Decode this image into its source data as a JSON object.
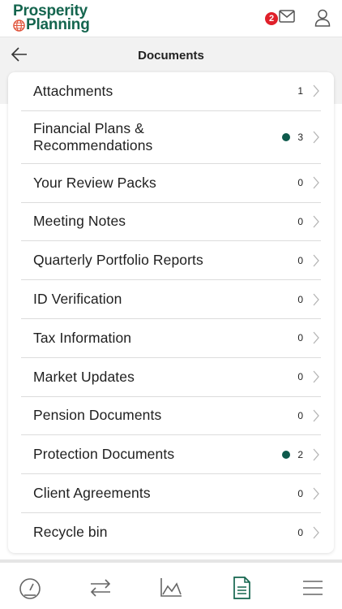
{
  "app": {
    "logo_line1": "Prosperity",
    "logo_line2": "Planning",
    "notification_count": "2",
    "brand_color": "#14654e",
    "badge_color": "#e0202a"
  },
  "header": {
    "title": "Documents"
  },
  "documents": [
    {
      "label": "Attachments",
      "count": "1",
      "has_dot": false
    },
    {
      "label": "Financial Plans & Recommendations",
      "count": "3",
      "has_dot": true
    },
    {
      "label": "Your Review Packs",
      "count": "0",
      "has_dot": false
    },
    {
      "label": "Meeting Notes",
      "count": "0",
      "has_dot": false
    },
    {
      "label": "Quarterly Portfolio Reports",
      "count": "0",
      "has_dot": false
    },
    {
      "label": "ID Verification",
      "count": "0",
      "has_dot": false
    },
    {
      "label": "Tax Information",
      "count": "0",
      "has_dot": false
    },
    {
      "label": "Market Updates",
      "count": "0",
      "has_dot": false
    },
    {
      "label": "Pension Documents",
      "count": "0",
      "has_dot": false
    },
    {
      "label": "Protection Documents",
      "count": "2",
      "has_dot": true
    },
    {
      "label": "Client Agreements",
      "count": "0",
      "has_dot": false
    },
    {
      "label": "Recycle bin",
      "count": "0",
      "has_dot": false
    }
  ],
  "nav": {
    "items": [
      {
        "icon": "dashboard-gauge-icon"
      },
      {
        "icon": "transfer-arrows-icon"
      },
      {
        "icon": "chart-icon"
      },
      {
        "icon": "document-icon",
        "active": true
      },
      {
        "icon": "menu-icon"
      }
    ],
    "active_color": "#14654e",
    "inactive_color": "#666666"
  }
}
